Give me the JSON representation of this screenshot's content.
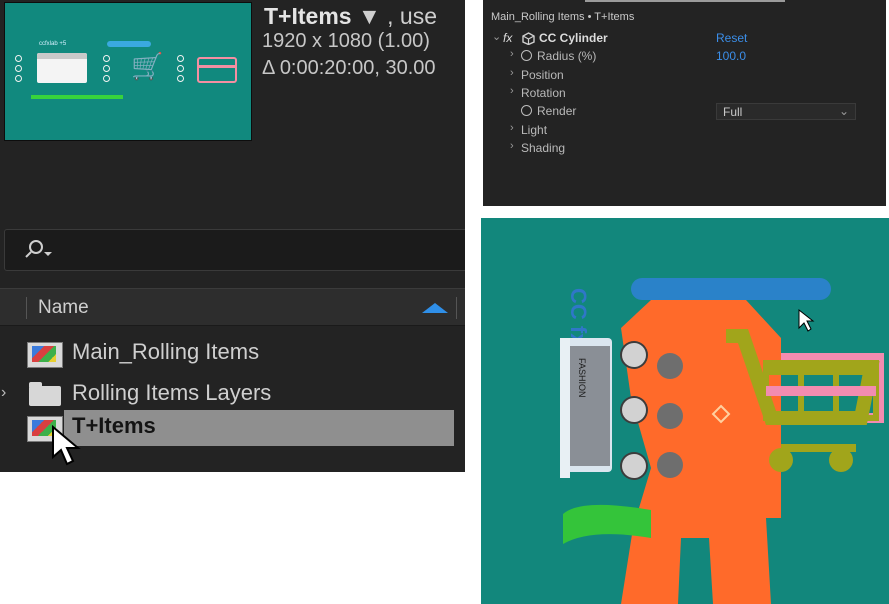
{
  "project": {
    "comp_name": "T+Items",
    "comp_name_suffix": "▼ , use",
    "resolution": "1920 x 1080 (1.00)",
    "duration": "Δ 0:00:20:00, 30.00",
    "search_placeholder": "",
    "column_name": "Name",
    "items": [
      {
        "label": "Main_Rolling Items",
        "type": "composition"
      },
      {
        "label": "Rolling Items Layers",
        "type": "folder"
      },
      {
        "label": "T+Items",
        "type": "composition",
        "selected": true
      }
    ]
  },
  "effects": {
    "breadcrumb": "Main_Rolling Items • T+Items",
    "effect_name": "CC Cylinder",
    "reset_label": "Reset",
    "fx_label": "fx",
    "properties": [
      {
        "label": "Radius (%)",
        "value": "100.0"
      },
      {
        "label": "Position"
      },
      {
        "label": "Rotation"
      },
      {
        "label": "Render",
        "value": "Full"
      },
      {
        "label": "Light"
      },
      {
        "label": "Shading"
      }
    ]
  },
  "viewer": {
    "logo_text": "CC fx",
    "card_text": "FASHION"
  },
  "colors": {
    "teal": "#12877c",
    "accent_blue": "#2f8fe8",
    "orange": "#ff6a2a",
    "olive": "#a1a51b",
    "pink": "#f28cb0",
    "green": "#34c43a"
  }
}
